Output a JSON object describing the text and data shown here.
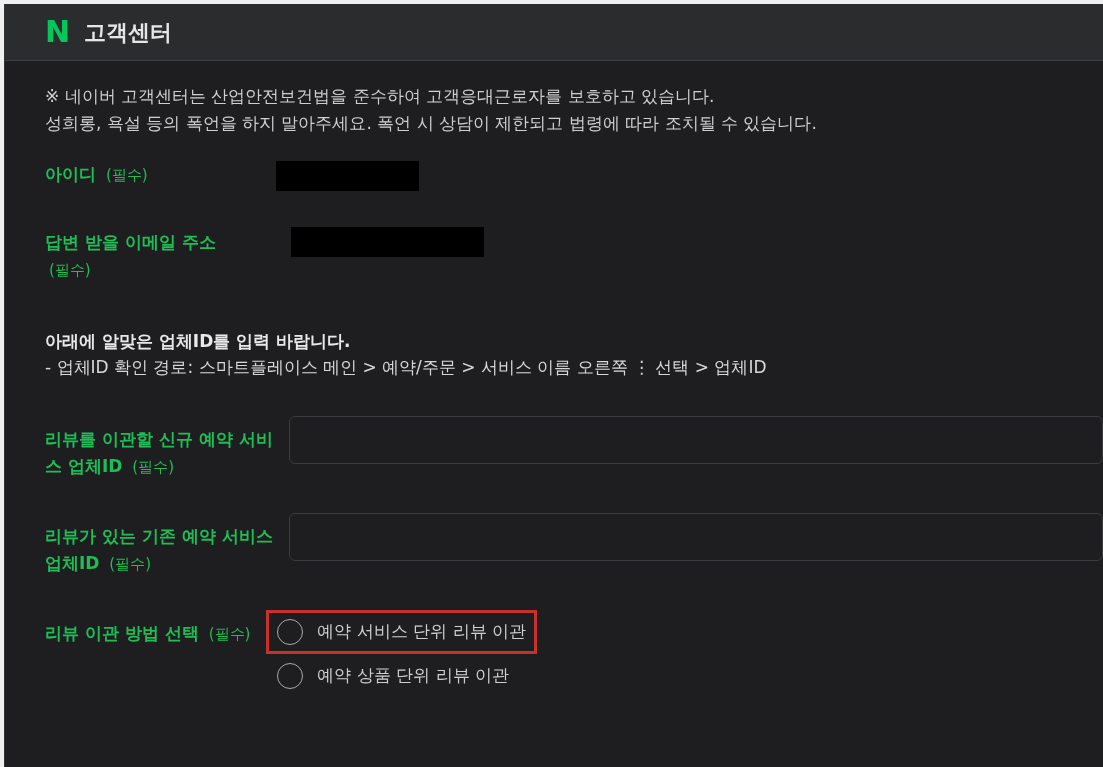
{
  "header": {
    "logo": "N",
    "title": "고객센터"
  },
  "notice": [
    "※ 네이버 고객센터는 산업안전보건법을 준수하여 고객응대근로자를 보호하고 있습니다.",
    "성희롱, 욕설 등의 폭언을 하지 말아주세요. 폭언 시 상담이 제한되고 법령에 따라 조치될 수 있습니다."
  ],
  "fields_top": [
    {
      "label": "아이디",
      "required": "(필수)",
      "kind": "redacted"
    },
    {
      "label": "답변 받을 이메일 주소",
      "required": "(필수)",
      "kind": "redacted"
    }
  ],
  "instruction": {
    "title": "아래에 알맞은 업체ID를 입력 바랍니다.",
    "path": "- 업체ID 확인 경로: 스마트플레이스 메인 > 예약/주문 > 서비스 이름 오른쪽 ⋮ 선택 > 업체ID"
  },
  "fields_bottom": [
    {
      "label": "리뷰를 이관할 신규 예약 서비스 업체ID",
      "required": "(필수)",
      "kind": "input"
    },
    {
      "label": "리뷰가 있는 기존 예약 서비스 업체ID",
      "required": "(필수)",
      "kind": "input"
    }
  ],
  "method": {
    "label": "리뷰 이관 방법 선택",
    "required": "(필수)",
    "options": [
      {
        "label": "예약 서비스 단위 리뷰 이관",
        "selected": false,
        "highlighted": true
      },
      {
        "label": "예약 상품 단위 리뷰 이관",
        "selected": false,
        "highlighted": false
      }
    ]
  }
}
